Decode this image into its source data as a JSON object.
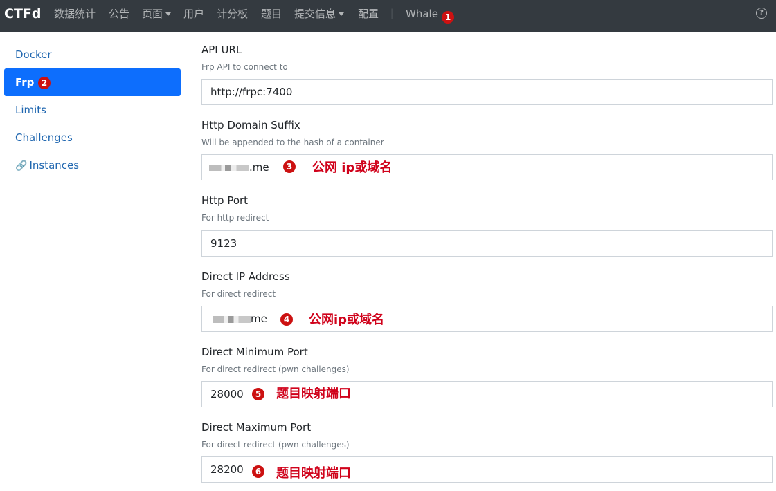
{
  "navbar": {
    "brand": "CTFd",
    "items": [
      "数据统计",
      "公告",
      "页面",
      "用户",
      "计分板",
      "题目",
      "提交信息",
      "配置"
    ],
    "separator": "|",
    "plugin": "Whale",
    "help_icon": "question-circle-icon"
  },
  "annotations": {
    "b1": "1",
    "b2": "2",
    "b3": "3",
    "b4": "4",
    "b5": "5",
    "b6": "6",
    "note_domain_1": "公网 ip或域名",
    "note_domain_2": "公网ip或域名",
    "note_port_1": "题目映射端口",
    "note_port_2": "题目映射端口",
    "badge_color": "#cc1111"
  },
  "sidebar": {
    "items": [
      {
        "label": "Docker"
      },
      {
        "label": "Frp"
      },
      {
        "label": "Limits"
      },
      {
        "label": "Challenges"
      },
      {
        "label": "Instances",
        "icon": "link-icon"
      }
    ],
    "active_color": "#0d6efd"
  },
  "form": {
    "api_url": {
      "label": "API URL",
      "help": "Frp API to connect to",
      "value": "http://frpc:7400"
    },
    "http_domain_suffix": {
      "label": "Http Domain Suffix",
      "help": "Will be appended to the hash of a container",
      "value_suffix": ".me"
    },
    "http_port": {
      "label": "Http Port",
      "help": "For http redirect",
      "value": "9123"
    },
    "direct_ip": {
      "label": "Direct IP Address",
      "help": "For direct redirect",
      "value_suffix": "me"
    },
    "direct_min_port": {
      "label": "Direct Minimum Port",
      "help": "For direct redirect (pwn challenges)",
      "value": "28000"
    },
    "direct_max_port": {
      "label": "Direct Maximum Port",
      "help": "For direct redirect (pwn challenges)",
      "value": "28200"
    }
  }
}
